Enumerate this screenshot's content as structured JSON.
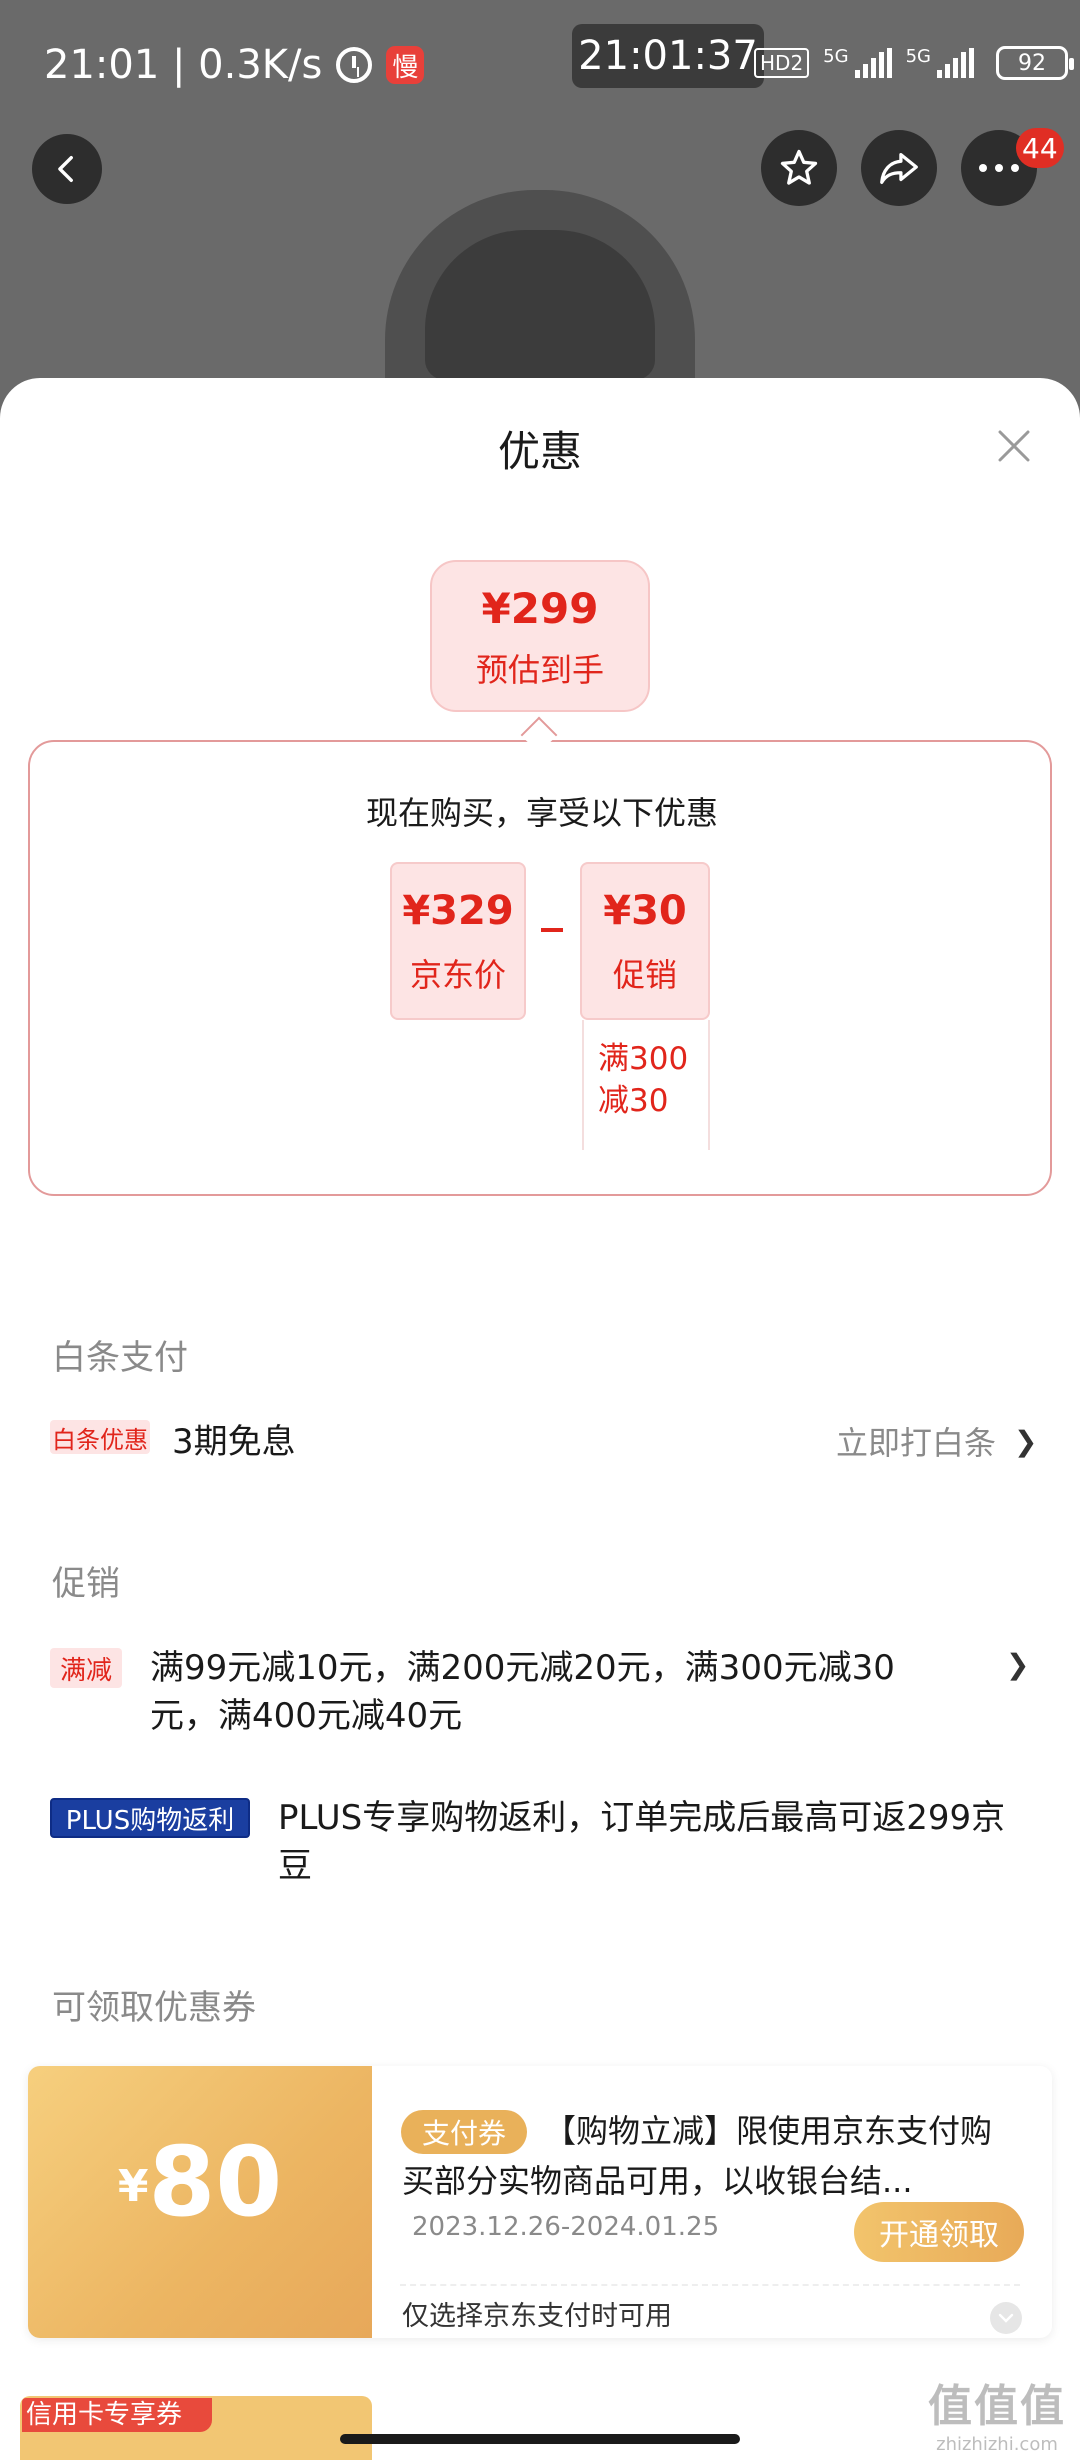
{
  "status_bar": {
    "time_speed": "21:01 | 0.3K/s",
    "slow_badge": "慢",
    "clock_overlay": "21:01:37",
    "hd_label": "HD2",
    "net_label_1": "5G",
    "net_label_2": "5G",
    "battery": "92"
  },
  "top_bar": {
    "more_badge": "44"
  },
  "sheet": {
    "title": "优惠",
    "estimate": {
      "price": "¥299",
      "label": "预估到手"
    },
    "calculation": {
      "title": "现在购买，享受以下优惠",
      "jd_price": {
        "value": "¥329",
        "label": "京东价"
      },
      "operator": "-",
      "promo": {
        "value": "¥30",
        "label": "促销",
        "detail": "满300减30"
      }
    },
    "baitiao": {
      "section_title": "白条支付",
      "tag": "白条优惠",
      "text": "3期免息",
      "action": "立即打白条",
      "chevron": "❯"
    },
    "promotion": {
      "section_title": "促销",
      "items": [
        {
          "tag": "满减",
          "text": "满99元减10元，满200元减20元，满300元减30元，满400元减40元"
        },
        {
          "tag": "PLUS购物返利",
          "text": "PLUS专享购物返利，订单完成后最高可返299京豆"
        }
      ]
    },
    "coupons": {
      "section_title": "可领取优惠券",
      "items": [
        {
          "currency": "¥",
          "amount": "80",
          "tag": "支付券",
          "description": "【购物立减】限使用京东支付购买部分实物商品可用，以收银台结...",
          "date_range": "2023.12.26-2024.01.25",
          "button": "开通领取",
          "note": "仅选择京东支付时可用"
        }
      ],
      "next_tag": "信用卡专享券"
    }
  },
  "watermark": {
    "logo": "值值值",
    "site": "zhizhizhi.com"
  },
  "colors": {
    "accent_red": "#e1251b",
    "coupon_gold": "#ecb562",
    "plus_blue": "#1a3ea0"
  }
}
